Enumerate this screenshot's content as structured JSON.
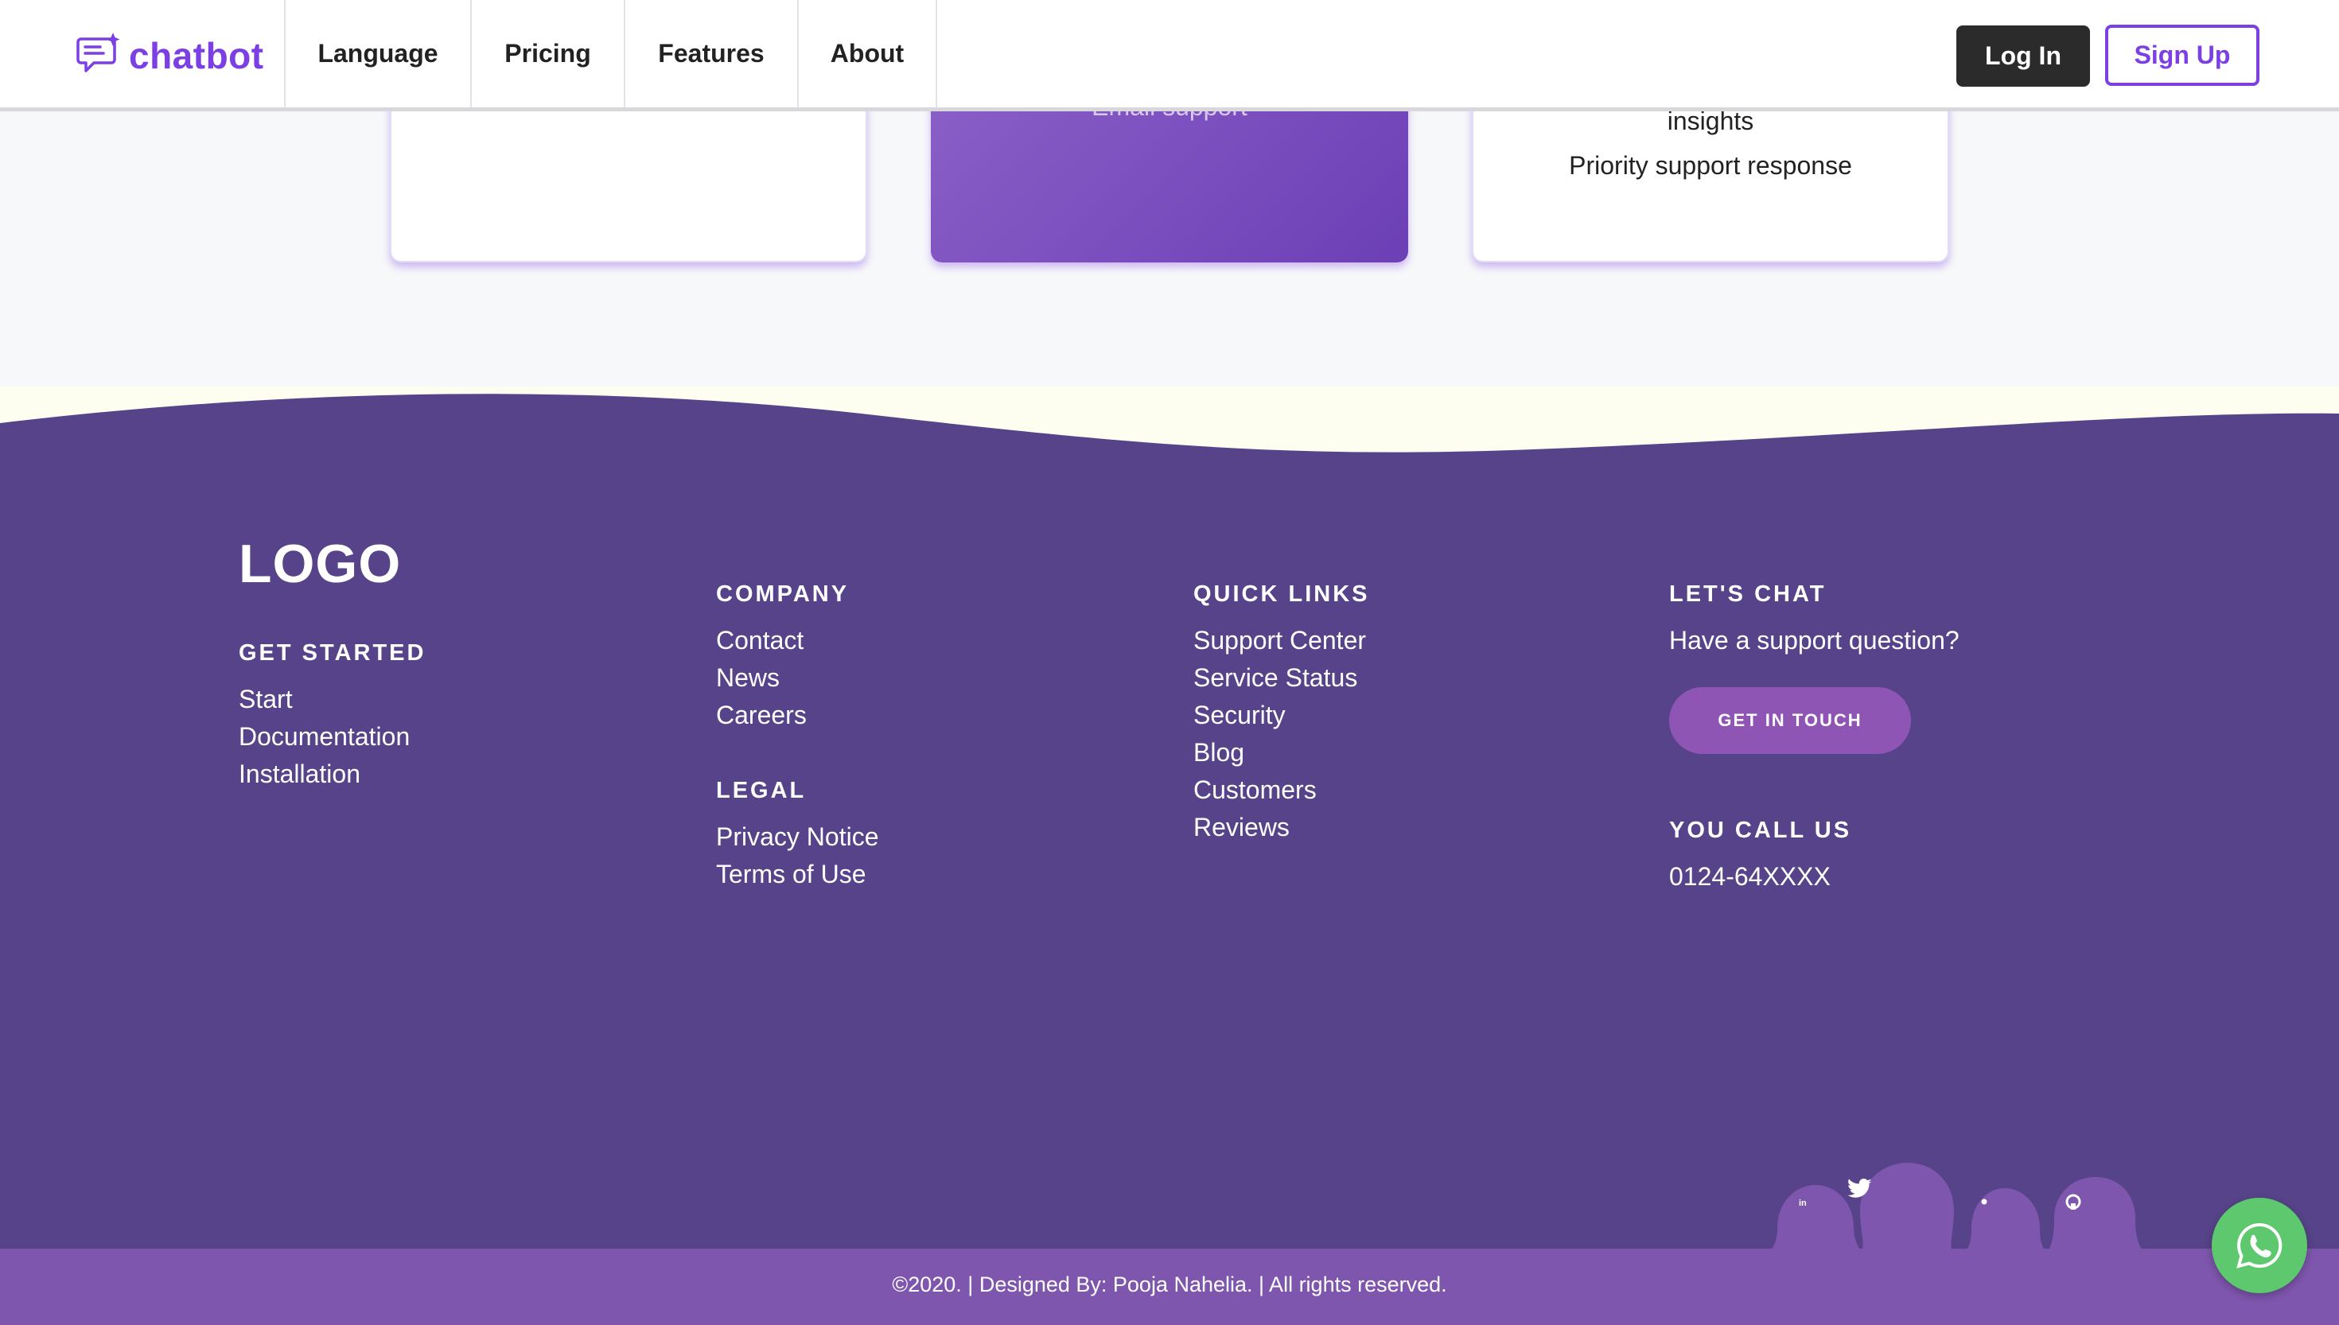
{
  "header": {
    "brand": "chatbot",
    "nav": [
      "Language",
      "Pricing",
      "Features",
      "About"
    ],
    "login_label": "Log In",
    "signup_label": "Sign Up"
  },
  "pricing_cards": {
    "middle_partial_text": "Email support",
    "right_partial_text": "insights",
    "right_text": "Priority support response"
  },
  "footer": {
    "logo": "LOGO",
    "get_started": {
      "heading": "GET STARTED",
      "links": [
        "Start",
        "Documentation",
        "Installation"
      ]
    },
    "company": {
      "heading": "COMPANY",
      "links": [
        "Contact",
        "News",
        "Careers"
      ]
    },
    "legal": {
      "heading": "LEGAL",
      "links": [
        "Privacy Notice",
        "Terms of Use"
      ]
    },
    "quick_links": {
      "heading": "QUICK LINKS",
      "links": [
        "Support Center",
        "Service Status",
        "Security",
        "Blog",
        "Customers",
        "Reviews"
      ]
    },
    "lets_chat": {
      "heading": "LET'S CHAT",
      "text": "Have a support question?",
      "button": "GET IN TOUCH"
    },
    "call": {
      "heading": "YOU CALL US",
      "phone": "0124-64XXXX"
    },
    "social_icons": [
      "linkedin-icon",
      "twitter-icon",
      "dot-icon",
      "github-icon"
    ],
    "copyright": "©2020. | Designed By: Pooja Nahelia. | All rights reserved."
  },
  "colors": {
    "brand": "#7b3fe4",
    "footer_bg": "#564389",
    "bottom_bar": "#7e56ad",
    "whatsapp": "#5dc86d"
  }
}
